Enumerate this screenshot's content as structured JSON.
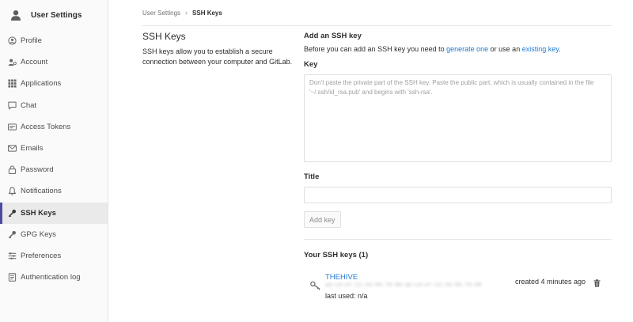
{
  "sidebar": {
    "title": "User Settings",
    "items": [
      {
        "label": "Profile",
        "icon": "profile-icon"
      },
      {
        "label": "Account",
        "icon": "account-icon"
      },
      {
        "label": "Applications",
        "icon": "applications-icon"
      },
      {
        "label": "Chat",
        "icon": "chat-icon"
      },
      {
        "label": "Access Tokens",
        "icon": "access-tokens-icon"
      },
      {
        "label": "Emails",
        "icon": "emails-icon"
      },
      {
        "label": "Password",
        "icon": "password-icon"
      },
      {
        "label": "Notifications",
        "icon": "notifications-icon"
      },
      {
        "label": "SSH Keys",
        "icon": "ssh-key-icon",
        "active": true
      },
      {
        "label": "GPG Keys",
        "icon": "gpg-key-icon"
      },
      {
        "label": "Preferences",
        "icon": "preferences-icon"
      },
      {
        "label": "Authentication log",
        "icon": "authentication-log-icon"
      }
    ]
  },
  "breadcrumb": {
    "parent": "User Settings",
    "separator": "›",
    "current": "SSH Keys"
  },
  "intro": {
    "title": "SSH Keys",
    "description": "SSH keys allow you to establish a secure connection between your computer and GitLab."
  },
  "form": {
    "heading": "Add an SSH key",
    "desc_before": "Before you can add an SSH key you need to ",
    "link_generate": "generate one",
    "desc_middle": " or use an ",
    "link_existing": "existing key",
    "desc_after": ".",
    "key_label": "Key",
    "key_placeholder": "Don't paste the private part of the SSH key. Paste the public part, which is usually contained in the file '~/.ssh/id_rsa.pub' and begins with 'ssh-rsa'.",
    "key_value": "",
    "title_label": "Title",
    "title_value": "",
    "add_button": "Add key"
  },
  "keys": {
    "heading": "Your SSH keys (1)",
    "items": [
      {
        "name": "THEHIVE",
        "fingerprint": "ab:cd:ef:12:34:56:78:90:ab:cd:ef:12:34:56:78:90",
        "last_used": "last used: n/a",
        "created": "created 4 minutes ago"
      }
    ]
  },
  "colors": {
    "link": "#1f78d1",
    "active_border": "#4b4ba3"
  }
}
